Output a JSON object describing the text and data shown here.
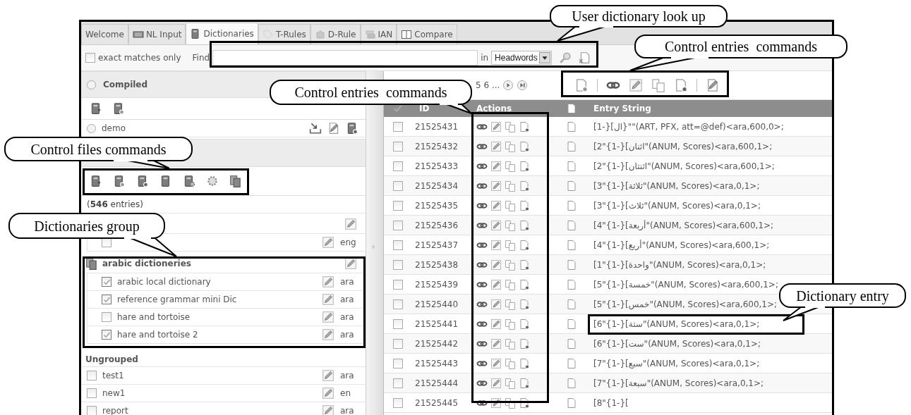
{
  "tabs": [
    {
      "label": "Welcome",
      "selected": false
    },
    {
      "label": "NL Input",
      "selected": false
    },
    {
      "label": "Dictionaries",
      "selected": true
    },
    {
      "label": "T-Rules",
      "selected": false
    },
    {
      "label": "D-Rule",
      "selected": false
    },
    {
      "label": "IAN",
      "selected": false
    },
    {
      "label": "Compare",
      "selected": false
    }
  ],
  "search": {
    "exact_label": "exact matches only",
    "exact_checked": false,
    "find_label": "Find",
    "in_label": "in",
    "field": "Headwords"
  },
  "compiled": {
    "title": "Compiled",
    "selected": false,
    "items": [
      {
        "name": "demo",
        "selected": false
      }
    ]
  },
  "entries_count": "(**546** entries)",
  "groups": [
    {
      "items": [
        {
          "checked": false,
          "lang": "eng"
        }
      ]
    },
    {
      "name": "arabic dictioneries",
      "items": [
        {
          "name": "arabic local dictionary",
          "checked": true,
          "lang": "ara"
        },
        {
          "name": "reference grammar mini Dic",
          "checked": true,
          "lang": "ara"
        },
        {
          "name": "hare and tortoise",
          "checked": false,
          "lang": "ara"
        },
        {
          "name": "hare and tortoise 2",
          "checked": true,
          "lang": "ara"
        }
      ]
    }
  ],
  "ungrouped": {
    "title": "Ungrouped",
    "items": [
      {
        "name": "test1",
        "checked": false,
        "lang": "ara"
      },
      {
        "name": "new1",
        "checked": false,
        "lang": "en"
      },
      {
        "name": "report",
        "checked": false,
        "lang": "ara"
      }
    ]
  },
  "pager": "5 6 ...",
  "table": {
    "columns": [
      "ID",
      "Actions",
      "Entry String"
    ],
    "rows": [
      {
        "id": "21525431",
        "checked": false,
        "entry": "[1-}[ال}\"\"(ART, PFX, att=@def)<ara,600,0>;"
      },
      {
        "id": "21525432",
        "checked": false,
        "entry": "[2\"{1-}[اثنان\"(ANUM, Scores)<ara,600,1>;"
      },
      {
        "id": "21525433",
        "checked": false,
        "entry": "[2\"{1-}[اثنتان\"(ANUM, Scores)<ara,600,1>;"
      },
      {
        "id": "21525434",
        "checked": false,
        "entry": "[3\"{1-}[ثلاثة\"(ANUM, Scores)<ara,0,1>;"
      },
      {
        "id": "21525435",
        "checked": false,
        "entry": "[3\"{1-}[ثلاث\"(ANUM, Scores)<ara,0,1>;"
      },
      {
        "id": "21525436",
        "checked": false,
        "entry": "[4\"{1-}[أربعة\"(ANUM, Scores)<ara,600,1>;"
      },
      {
        "id": "21525437",
        "checked": false,
        "entry": "[4\"{1-}[أربع\"(ANUM, Scores)<ara,600,1>;"
      },
      {
        "id": "21525438",
        "checked": false,
        "entry": "[1\"{1-}[واحدة\"(ANUM, Scores)<ara,0,1>;"
      },
      {
        "id": "21525439",
        "checked": false,
        "entry": "[5\"{1-}[خمسة\"(ANUM, Scores)<ara,600,1>;"
      },
      {
        "id": "21525440",
        "checked": false,
        "entry": "[5\"{1-}[خمس\"(ANUM, Scores)<ara,600,1>;"
      },
      {
        "id": "21525441",
        "checked": false,
        "entry": "[6\"{1-}[ستة\"(ANUM, Scores)<ara,0,1>;"
      },
      {
        "id": "21525442",
        "checked": false,
        "entry": "[6\"{1-}[ست\"(ANUM, Scores)<ara,0,1>;"
      },
      {
        "id": "21525443",
        "checked": false,
        "entry": "[7\"{1-}[سبع\"(ANUM, Scores)<ara,0,1>;"
      },
      {
        "id": "21525444",
        "checked": false,
        "entry": "[7\"{1-}[سبعة\"(ANUM, Scores)<ara,0,1>;"
      },
      {
        "id": "21525445",
        "checked": false,
        "entry": "[8\"{1-}["
      }
    ]
  },
  "annotations": [
    "User dictionary look up",
    "Control entries  commands",
    "Control entries  commands",
    "Control files commands",
    "Dictionaries group",
    "Dictionary entry"
  ]
}
